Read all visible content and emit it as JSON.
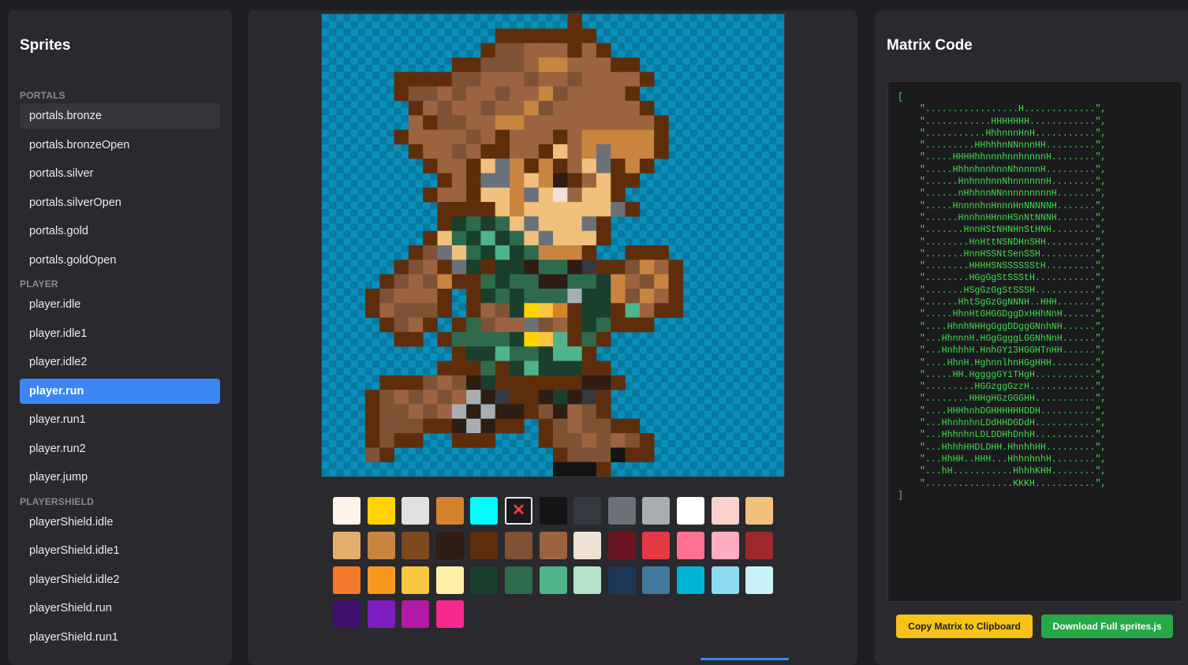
{
  "sidebar": {
    "title": "Sprites",
    "groups": [
      {
        "label": "PORTALS",
        "items": [
          "portals.bronze",
          "portals.bronzeOpen",
          "portals.silver",
          "portals.silverOpen",
          "portals.gold",
          "portals.goldOpen"
        ]
      },
      {
        "label": "PLAYER",
        "items": [
          "player.idle",
          "player.idle1",
          "player.idle2",
          "player.run",
          "player.run1",
          "player.run2",
          "player.jump"
        ]
      },
      {
        "label": "PLAYERSHIELD",
        "items": [
          "playerShield.idle",
          "playerShield.idle1",
          "playerShield.idle2",
          "playerShield.run",
          "playerShield.run1"
        ]
      }
    ],
    "active_item": "player.run",
    "hovered_item": "portals.bronze"
  },
  "editor": {
    "canvas_bg": "#0a8fb8",
    "canvas_bg_alt": "#0578a0",
    "palette": [
      "#fdf3e8",
      "#ffd400",
      "#e0e0e0",
      "#d4822e",
      "#00ffff",
      "eraser",
      "#141414",
      "#343840",
      "#6b7179",
      "#a8aeb4",
      "#ffffff",
      "#fbcfcc",
      "#f0c07c",
      "#e3ae6c",
      "#c9853f",
      "#7d4a20",
      "#2e1d12",
      "#5e2e0c",
      "#7e5235",
      "#9c6340",
      "#ede2d4",
      "#6a1620",
      "#e63946",
      "#ff7090",
      "#ffadc0",
      "#9c2a2a",
      "#f47a2a",
      "#f7981f",
      "#f9c542",
      "#fff0a8",
      "#1a3f2c",
      "#2e6b4c",
      "#4fb48a",
      "#b4e4c8",
      "#1e3658",
      "#44789e",
      "#00b4d8",
      "#8edcf0",
      "#caf0f8",
      "#3f0f6e",
      "#7e1dbe",
      "#b31aa5",
      "#f52a8c"
    ],
    "eraser_glyph": "✕"
  },
  "matrix": {
    "title": "Matrix Code",
    "open": "[",
    "close": "]",
    "rows": [
      ".................H.............",
      "............HHHHHHH............",
      "...........HhhnnnHnH...........",
      ".........HHhhhnNNnnnHH.........",
      ".....HHHHhhnnnhnnhnnnnH........",
      ".....HhhnhnnhnnNhnnnnH.........",
      "......HnhnnhnnNhnnnnnnH........",
      "......nHhhnnNNnnnnnnnnnH.......",
      ".....HnnnnhnHnnnHnNNNNNH.......",
      "......HnnhnHHnnHSnNtNNNH.......",
      ".......HnnHStNHNHnStHNH........",
      "........HnHttNSNDHnSHH.........",
      ".......HnnHSSNtSenSSH..........",
      "........HHHHSNSSSSSStH.........",
      "........HGgGgStSSStH...........",
      ".......HSgGzGgStSSSH...........",
      "......HhtSgGzGgNNNH..HHH.......",
      ".....HhnHtGHGGDggDxHHhNnH......",
      "....HhnhNHHgGggDDggGNnhNH......",
      "...HhnnnH.HGgGgggLGGNhNnH......",
      "...HnhhhH.HnhGY13HGGHTnHH......",
      "....HhnH.HghnnlhnHGgHHH........",
      ".....HH.HggggGY1THgH...........",
      ".........HGGzggGzzH............",
      "........HHHgHGzGGGHH...........",
      "....HHHhnhDGHHHHHHDDH..........",
      "...HhnhnhnLDdHHDGDdH...........",
      "...HhhnhnLDLDDHhDnhH...........",
      "...HhhhHHDLDHH.HhnhhHH.........",
      "...HhHH..HHH...HhhnhnhH........",
      "...hH...........HhhhKHH........",
      "................KKKH..........."
    ]
  },
  "buttons": {
    "copy_label": "Copy Matrix to Clipboard",
    "download_label": "Download Full sprites.js"
  }
}
